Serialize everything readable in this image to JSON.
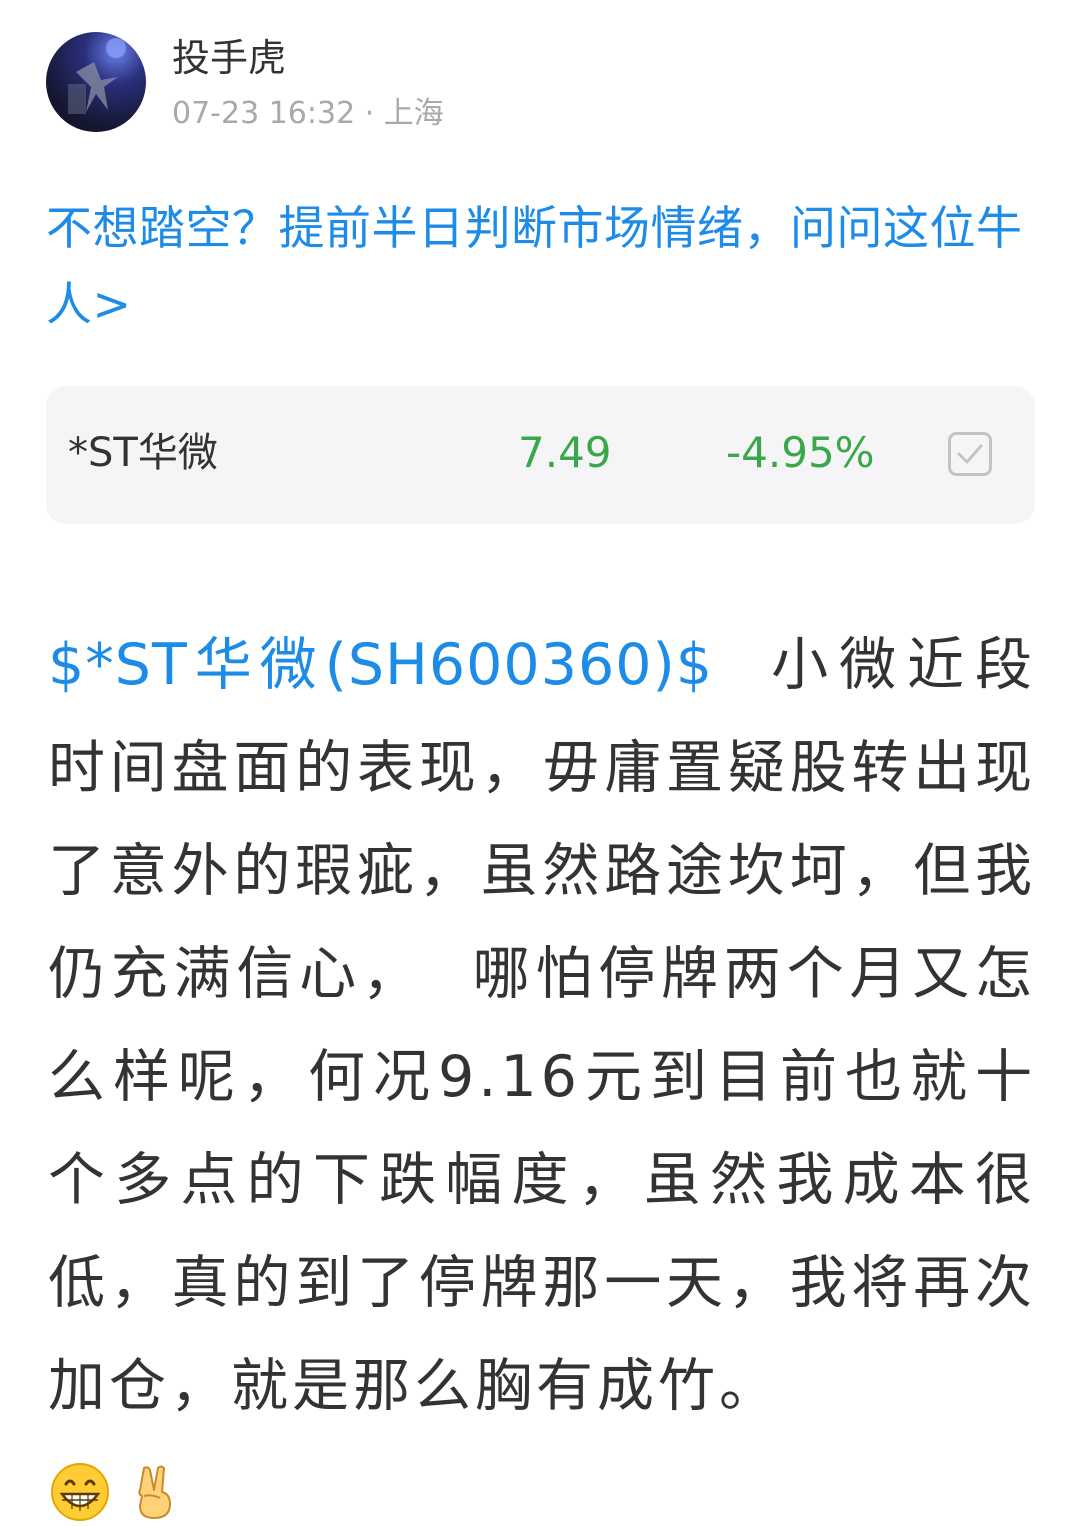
{
  "author": {
    "name": "投手虎",
    "meta": "07-23 16:32 · 上海"
  },
  "promo": {
    "text": "不想踏空？提前半日判断市场情绪，问问这位牛人>"
  },
  "stock_card": {
    "name": "*ST华微",
    "price": "7.49",
    "change": "-4.95%",
    "color_down": "#3aa74a"
  },
  "post": {
    "stock_tag": "$*ST华微(SH600360)$",
    "text": "  小微近段时间盘面的表现，毋庸置疑股转出现了意外的瑕疵，虽然路途坎坷，但我仍充满信心，  哪怕停牌两个月又怎么样呢，何况9.16元到目前也就十个多点的下跌幅度，虽然我成本很低，真的到了停牌那一天，我将再次加仓，就是那么胸有成竹。"
  },
  "emojis": [
    "grinning-face",
    "victory-hand"
  ],
  "colors": {
    "link": "#1d8be8",
    "text": "#333333",
    "meta": "#a9a9a9",
    "card_bg": "#f5f5f7"
  }
}
